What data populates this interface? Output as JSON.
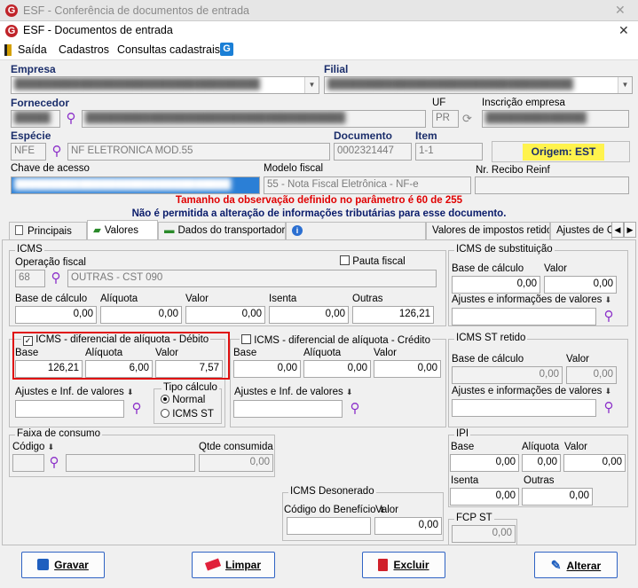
{
  "bg_window": {
    "title": "ESF - Conferência de documentos de entrada"
  },
  "window": {
    "title": "ESF - Documentos de entrada"
  },
  "menu": {
    "items": [
      "Saída",
      "Cadastros",
      "Consultas cadastrais"
    ]
  },
  "header": {
    "empresa_label": "Empresa",
    "filial_label": "Filial",
    "fornecedor_label": "Fornecedor",
    "uf_label": "UF",
    "uf_value": "PR",
    "inscricao_label": "Inscrição empresa",
    "especie_label": "Espécie",
    "especie_code": "NFE",
    "especie_desc": "NF ELETRONICA MOD.55",
    "documento_label": "Documento",
    "documento_value": "0002321447",
    "item_label": "Item",
    "item_value": "1-1",
    "origem": "Origem: EST",
    "chave_label": "Chave de acesso",
    "modelo_label": "Modelo fiscal",
    "modelo_value": "55 - Nota Fiscal Eletrônica - NF-e",
    "recibo_label": "Nr. Recibo Reinf"
  },
  "warnings": [
    "Tamanho da observação definido no parâmetro é 60 de 255",
    "Não é permitida a alteração de informações tributárias para esse documento."
  ],
  "tabs": [
    "Principais",
    "Valores",
    "Dados do transportador",
    "Valores de impostos retidos",
    "Ajustes de C"
  ],
  "icms": {
    "label": "ICMS",
    "operacao_label": "Operação fiscal",
    "operacao_code": "68",
    "operacao_desc": "OUTRAS - CST 090",
    "pauta_label": "Pauta fiscal",
    "base_label": "Base de cálculo",
    "aliquota_label": "Alíquota",
    "valor_label": "Valor",
    "isenta_label": "Isenta",
    "outras_label": "Outras",
    "base": "0,00",
    "aliquota": "0,00",
    "valor": "0,00",
    "isenta": "0,00",
    "outras": "126,21"
  },
  "difal_debito": {
    "label": "ICMS - diferencial de alíquota - Débito",
    "base_label": "Base",
    "aliquota_label": "Alíquota",
    "valor_label": "Valor",
    "base": "126,21",
    "aliquota": "6,00",
    "valor": "7,57",
    "ajustes_label": "Ajustes e Inf. de valores",
    "tipo_label": "Tipo cálculo",
    "tipo_normal": "Normal",
    "tipo_st": "ICMS ST"
  },
  "difal_credito": {
    "label": "ICMS - diferencial de alíquota - Crédito",
    "base_label": "Base",
    "aliquota_label": "Alíquota",
    "valor_label": "Valor",
    "base": "0,00",
    "aliquota": "0,00",
    "valor": "0,00",
    "ajustes_label": "Ajustes e Inf. de valores"
  },
  "icms_st": {
    "label": "ICMS de substituição",
    "base_label": "Base de cálculo",
    "valor_label": "Valor",
    "base": "0,00",
    "valor": "0,00",
    "ajustes_label": "Ajustes e informações de valores"
  },
  "icms_st_retido": {
    "label": "ICMS ST retido",
    "base_label": "Base de cálculo",
    "valor_label": "Valor",
    "base": "0,00",
    "valor": "0,00",
    "ajustes_label": "Ajustes e informações de valores"
  },
  "faixa": {
    "label": "Faixa de consumo",
    "codigo_label": "Código",
    "qtde_label": "Qtde consumida",
    "qtde": "0,00"
  },
  "ipi": {
    "label": "IPI",
    "base_label": "Base",
    "aliquota_label": "Alíquota",
    "valor_label": "Valor",
    "base": "0,00",
    "aliquota": "0,00",
    "valor": "0,00",
    "isenta_label": "Isenta",
    "outras_label": "Outras",
    "isenta": "0,00",
    "outras": "0,00"
  },
  "desonerado": {
    "label": "ICMS Desonerado",
    "codigo_label": "Código do Benefício",
    "valor_label": "Valor",
    "valor": "0,00"
  },
  "fcp": {
    "label": "FCP ST",
    "value": "0,00"
  },
  "buttons": {
    "gravar": "Gravar",
    "limpar": "Limpar",
    "excluir": "Excluir",
    "alterar": "Alterar"
  },
  "colors": {
    "label_blue": "#1b2e6b",
    "warning_red": "#e00000",
    "warning_blue": "#0a1c6b",
    "origem_bg": "#fff34d",
    "highlight": "#e01010",
    "logo_red": "#c0242a"
  }
}
